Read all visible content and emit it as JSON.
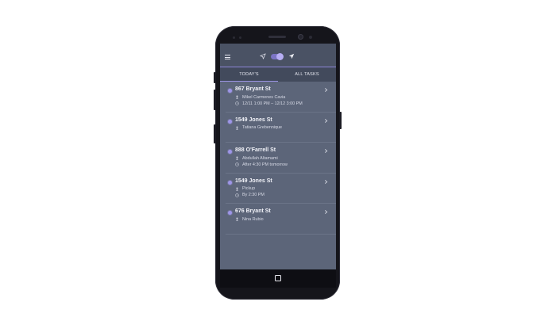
{
  "appbar": {
    "menu_icon": "hamburger-menu-icon",
    "nav_off_icon": "navigation-arrow-outline-icon",
    "nav_on_icon": "navigation-arrow-filled-icon",
    "toggle_on": true,
    "accent_color": "#8e86d8"
  },
  "tabs": [
    {
      "label": "TODAY'S",
      "active": true
    },
    {
      "label": "ALL TASKS",
      "active": false
    }
  ],
  "tasks": [
    {
      "address": "867 Bryant St",
      "person": "Mikel Carmenes Cavia",
      "time": "12/11 1:00 PM – 12/12 3:00 PM"
    },
    {
      "address": "1549 Jones St",
      "person": "Tatiana Grebennique",
      "time": ""
    },
    {
      "address": "888 O'Farrell St",
      "person": "Abdullah Altamami",
      "time": "After 4:30 PM tomorrow"
    },
    {
      "address": "1549 Jones St",
      "person": "Pickup",
      "time": "By 2:30 PM"
    },
    {
      "address": "676 Bryant St",
      "person": "Nina Rubio",
      "time": ""
    }
  ],
  "icons": {
    "person": "person-pin-icon",
    "clock": "clock-icon",
    "chevron": "chevron-right-icon",
    "status_dot": "status-dot-icon",
    "home": "home-button-icon"
  }
}
